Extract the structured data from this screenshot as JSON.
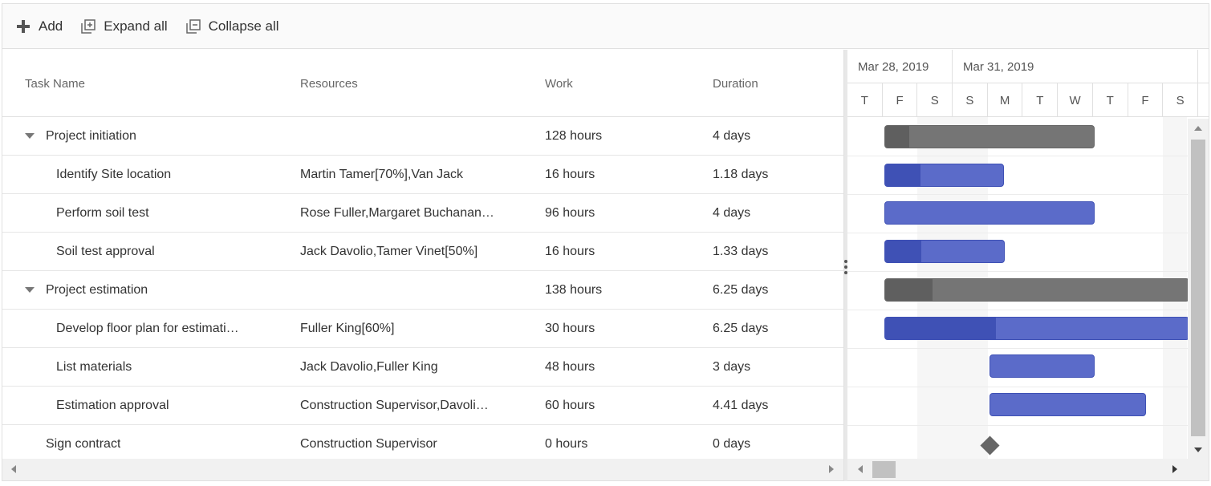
{
  "toolbar": {
    "add_label": "Add",
    "expand_label": "Expand all",
    "collapse_label": "Collapse all"
  },
  "grid": {
    "columns": [
      "Task Name",
      "Resources",
      "Work",
      "Duration"
    ],
    "rows": [
      {
        "name": "Project initiation",
        "resources": "",
        "work": "128 hours",
        "duration": "4 days",
        "parent": true
      },
      {
        "name": "Identify Site location",
        "resources": "Martin Tamer[70%],Van Jack",
        "work": "16 hours",
        "duration": "1.18 days",
        "parent": false
      },
      {
        "name": "Perform soil test",
        "resources": "Rose Fuller,Margaret Buchanan…",
        "work": "96 hours",
        "duration": "4 days",
        "parent": false
      },
      {
        "name": "Soil test approval",
        "resources": "Jack Davolio,Tamer Vinet[50%]",
        "work": "16 hours",
        "duration": "1.33 days",
        "parent": false
      },
      {
        "name": "Project estimation",
        "resources": "",
        "work": "138 hours",
        "duration": "6.25 days",
        "parent": true
      },
      {
        "name": "Develop floor plan for estimati…",
        "resources": "Fuller King[60%]",
        "work": "30 hours",
        "duration": "6.25 days",
        "parent": false
      },
      {
        "name": "List materials",
        "resources": "Jack Davolio,Fuller King",
        "work": "48 hours",
        "duration": "3 days",
        "parent": false
      },
      {
        "name": "Estimation approval",
        "resources": "Construction Supervisor,Davoli…",
        "work": "60 hours",
        "duration": "4.41 days",
        "parent": false
      },
      {
        "name": "Sign contract",
        "resources": "Construction Supervisor",
        "work": "0 hours",
        "duration": "0 days",
        "parent": false
      }
    ]
  },
  "timeline": {
    "weeks": [
      "Mar 28, 2019",
      "Mar 31, 2019"
    ],
    "days": [
      "T",
      "F",
      "S",
      "S",
      "M",
      "T",
      "W",
      "T",
      "F",
      "S"
    ]
  },
  "colors": {
    "parent_bar": "#757575",
    "parent_progress": "#5f5f5f",
    "child_bar": "#5b6bc9",
    "child_progress": "#3f51b5",
    "milestone": "#666666"
  }
}
